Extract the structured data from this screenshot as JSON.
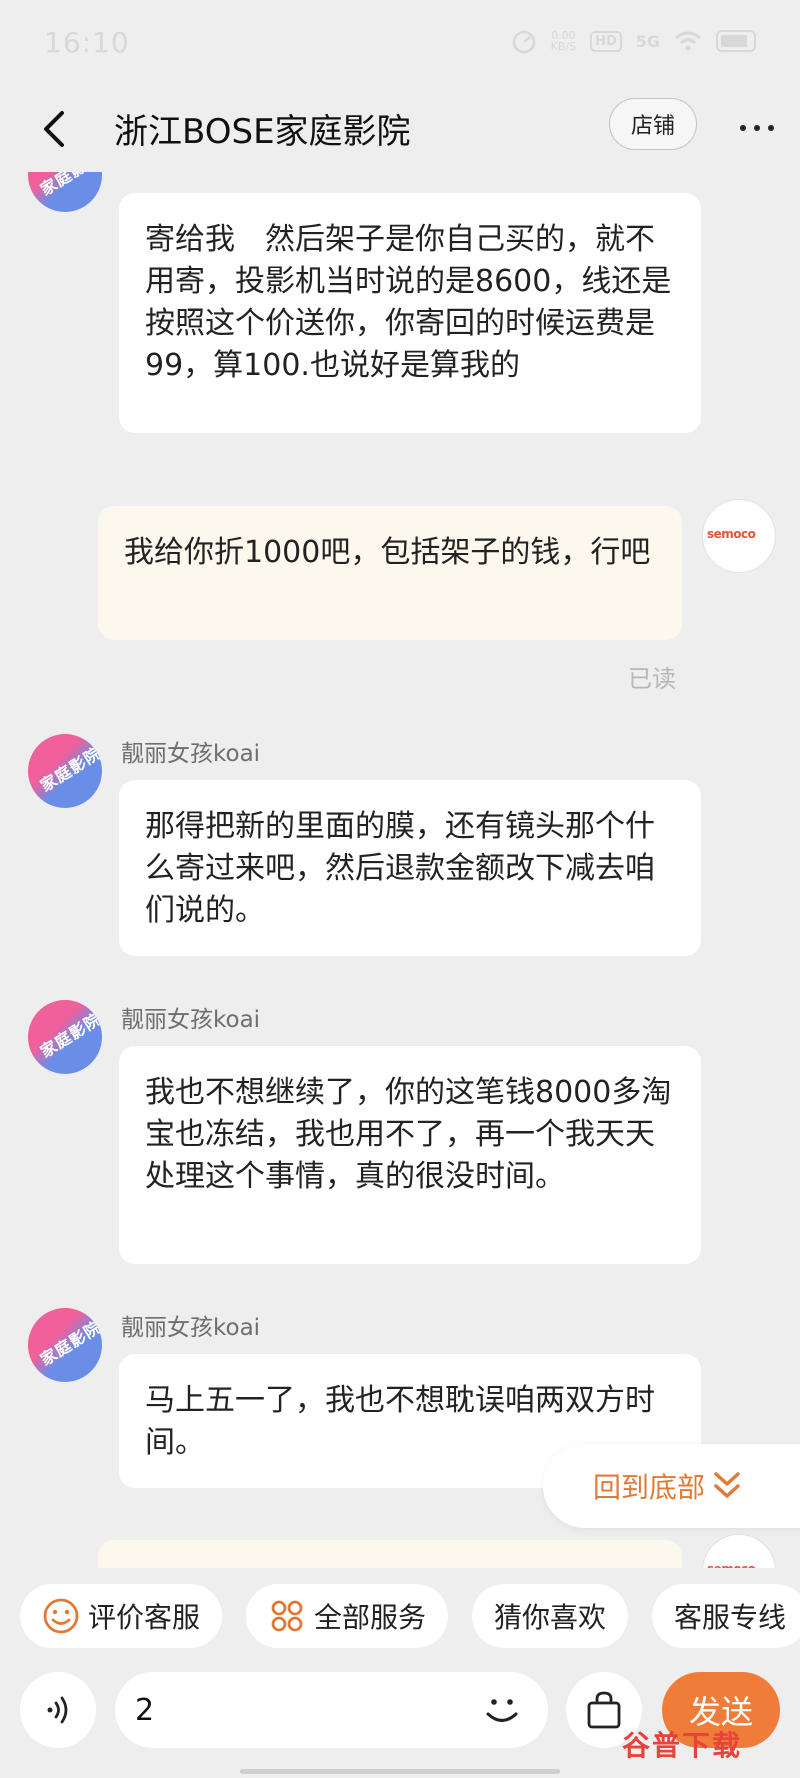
{
  "status_bar": {
    "time": "16:10",
    "net_speed": "0.00\nKB/S",
    "hd": "HD",
    "signal": "5G"
  },
  "header": {
    "title": "浙江BOSE家庭影院",
    "shop_label": "店铺"
  },
  "messages": [
    {
      "side": "left",
      "sender": "",
      "text": "寄给我　然后架子是你自己买的，就不用寄，投影机当时说的是8600，线还是按照这个价送你，你寄回的时候运费是99，算100.也说好是算我的"
    },
    {
      "side": "right",
      "text": "我给你折1000吧，包括架子的钱，行吧",
      "read_label": "已读"
    },
    {
      "side": "left",
      "sender": "靓丽女孩koai",
      "text": "那得把新的里面的膜，还有镜头那个什么寄过来吧，然后退款金额改下减去咱们说的。"
    },
    {
      "side": "left",
      "sender": "靓丽女孩koai",
      "text": "我也不想继续了，你的这笔钱8000多淘宝也冻结，我也用不了，再一个我天天处理这个事情，真的很没时间。"
    },
    {
      "side": "left",
      "sender": "靓丽女孩koai",
      "text": "马上五一了，我也不想耽误咱两双方时间。"
    }
  ],
  "avatars": {
    "shop_text": "家庭影院",
    "user_text": "semoco"
  },
  "scroll_bottom_label": "回到底部",
  "quick_actions": [
    {
      "label": "评价客服",
      "icon": "smiley-icon"
    },
    {
      "label": "全部服务",
      "icon": "grid-icon"
    },
    {
      "label": "猜你喜欢",
      "icon": ""
    },
    {
      "label": "客服专线",
      "icon": ""
    }
  ],
  "input": {
    "value": "2",
    "send_label": "发送"
  },
  "watermark": "谷普下载",
  "colors": {
    "accent": "#f07c3a",
    "scroll_text": "#e27a37",
    "right_bubble": "#fcf8ee"
  }
}
